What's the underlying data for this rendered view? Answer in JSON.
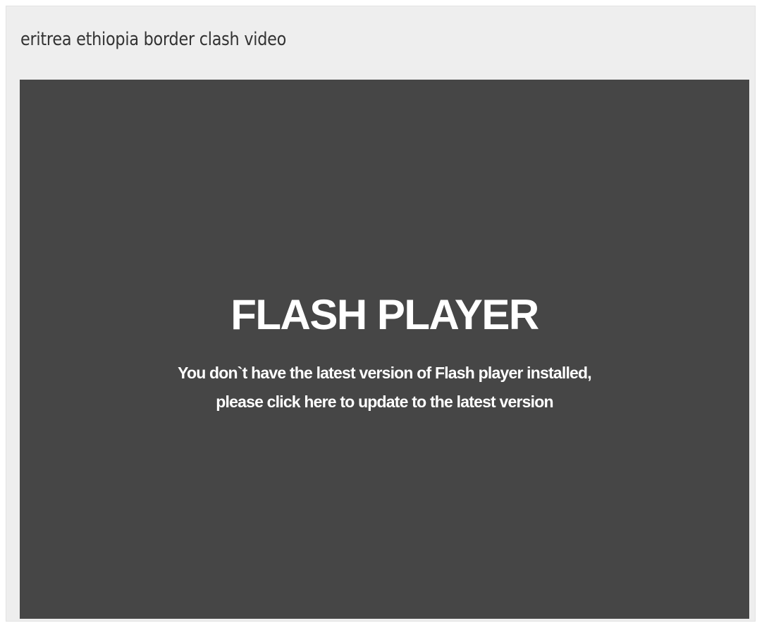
{
  "video": {
    "title": "eritrea ethiopia border clash video"
  },
  "player": {
    "heading": "FLASH PLAYER",
    "message_line1": "You don`t have the latest version of Flash player installed,",
    "message_line2": "please click here to update to the latest version"
  },
  "colors": {
    "panel_background": "#eeeeee",
    "player_background": "#464646",
    "player_text": "#ffffff",
    "title_text": "#333333"
  }
}
